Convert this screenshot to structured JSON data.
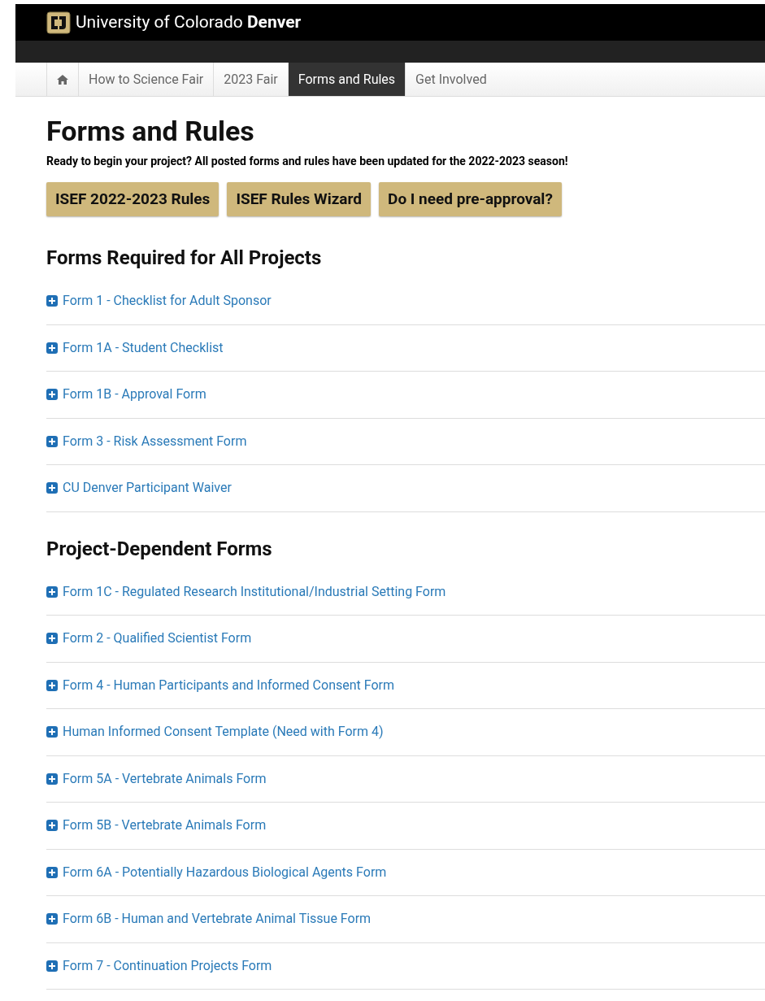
{
  "header": {
    "title": "University of Colorado **Denver**"
  },
  "nav": [
    {
      "kind": "home",
      "selected": false
    },
    {
      "kind": "link",
      "label": "How to Science Fair",
      "selected": false
    },
    {
      "kind": "link",
      "label": "2023 Fair",
      "selected": false
    },
    {
      "kind": "link",
      "label": "Forms and Rules",
      "selected": true
    },
    {
      "kind": "link",
      "label": "Get Involved",
      "selected": false
    }
  ],
  "page": {
    "title": "Forms and Rules",
    "intro": "Ready to begin your project? All posted forms and rules have been updated for the 2022-2023 season!"
  },
  "buttons": [
    "ISEF 2022-2023 Rules",
    "ISEF Rules Wizard",
    "Do I need pre-approval?"
  ],
  "sections": [
    {
      "heading": "Forms Required for All Projects",
      "items": [
        {
          "label": "Form 1 - Checklist for Adult Sponsor",
          "expanded": false
        },
        {
          "label": "Form 1A - Student Checklist",
          "expanded": false
        },
        {
          "label": "Form 1B - Approval Form",
          "expanded": false
        },
        {
          "label": "Form 3 - Risk Assessment Form",
          "expanded": false
        },
        {
          "label": "CU Denver Participant Waiver",
          "expanded": false
        }
      ]
    },
    {
      "heading": "Project-Dependent Forms",
      "items": [
        {
          "label": "Form 1C - Regulated Research Institutional/Industrial Setting Form",
          "expanded": false
        },
        {
          "label": "Form 2 - Qualified Scientist Form",
          "expanded": false
        },
        {
          "label": "Form 4 - Human Participants and Informed Consent Form",
          "expanded": false
        },
        {
          "label": "Human Informed Consent Template (Need with Form 4)",
          "expanded": false
        },
        {
          "label": "Form 5A - Vertebrate Animals Form",
          "expanded": false
        },
        {
          "label": "Form 5B - Vertebrate Animals Form",
          "expanded": false
        },
        {
          "label": "Form 6A - Potentially Hazardous Biological Agents Form",
          "expanded": false
        },
        {
          "label": "Form 6B - Human and Vertebrate Animal Tissue Form",
          "expanded": false
        },
        {
          "label": "Form 7 - Continuation Projects Form",
          "expanded": false
        }
      ]
    }
  ]
}
